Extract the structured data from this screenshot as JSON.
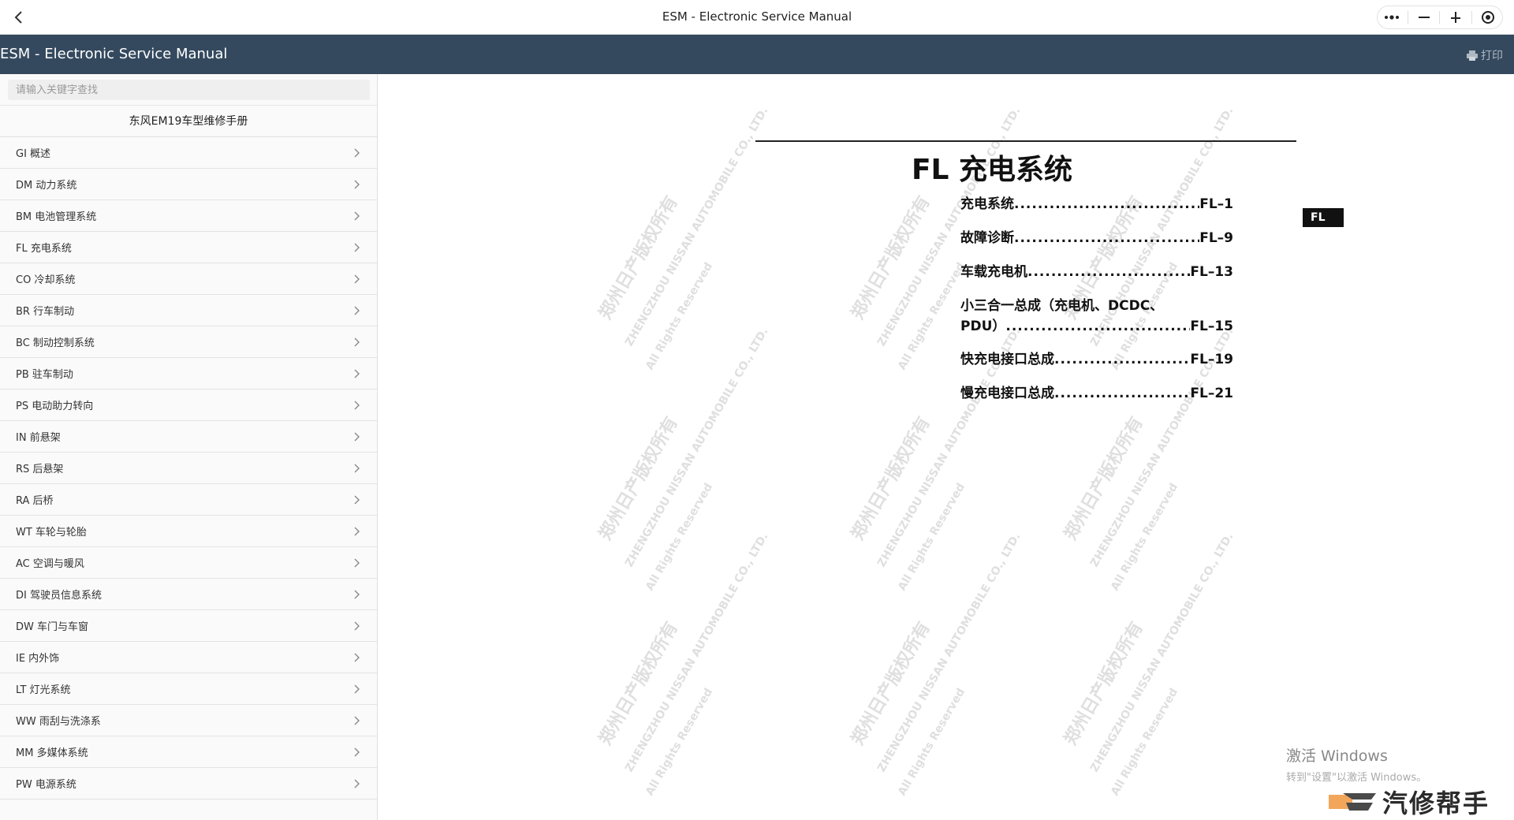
{
  "window": {
    "title": "ESM - Electronic Service Manual",
    "icons": [
      "back-arrow-icon",
      "more-icon",
      "minimize-icon",
      "pin-icon",
      "record-icon"
    ]
  },
  "header": {
    "title": "ESM - Electronic Service Manual",
    "print_label": "打印",
    "print_icon": "printer-icon"
  },
  "sidebar": {
    "search_placeholder": "请输入关键字查找",
    "book_title": "东风EM19车型维修手册",
    "items": [
      {
        "label": "GI 概述"
      },
      {
        "label": "DM 动力系统"
      },
      {
        "label": "BM 电池管理系统"
      },
      {
        "label": "FL 充电系统"
      },
      {
        "label": "CO 冷却系统"
      },
      {
        "label": "BR 行车制动"
      },
      {
        "label": "BC 制动控制系统"
      },
      {
        "label": "PB 驻车制动"
      },
      {
        "label": "PS 电动助力转向"
      },
      {
        "label": "IN 前悬架"
      },
      {
        "label": "RS 后悬架"
      },
      {
        "label": "RA 后桥"
      },
      {
        "label": "WT 车轮与轮胎"
      },
      {
        "label": "AC 空调与暖风"
      },
      {
        "label": "DI 驾驶员信息系统"
      },
      {
        "label": "DW 车门与车窗"
      },
      {
        "label": "IE 内外饰"
      },
      {
        "label": "LT 灯光系统"
      },
      {
        "label": "WW 雨刮与洗涤系"
      },
      {
        "label": "MM 多媒体系统"
      },
      {
        "label": "PW 电源系统"
      }
    ]
  },
  "document": {
    "title": "FL 充电系统",
    "tab_label": "FL",
    "toc": [
      {
        "title": "充电系统",
        "page": "FL–1"
      },
      {
        "title": "故障诊断",
        "page": "FL–9"
      },
      {
        "title": "车载充电机",
        "page": "FL–13"
      },
      {
        "title_line1": "小三合一总成（充电机、DCDC、",
        "title": "PDU）",
        "page": "FL–15"
      },
      {
        "title": "快充电接口总成",
        "page": "FL–19"
      },
      {
        "title": "慢充电接口总成",
        "page": "FL–21"
      }
    ],
    "watermark_cn": "郑州日产版权所有",
    "watermark_en": "ZHENGZHOU NISSAN AUTOMOBILE CO., LTD.",
    "watermark_rights": "All Rights Reserved"
  },
  "overlay": {
    "activate_title": "激活 Windows",
    "activate_sub": "转到\"设置\"以激活 Windows。",
    "brand_name": "汽修帮手"
  },
  "colors": {
    "header_bg": "#34495e",
    "sidebar_bg": "#fafafa",
    "text_dark": "#111111"
  }
}
